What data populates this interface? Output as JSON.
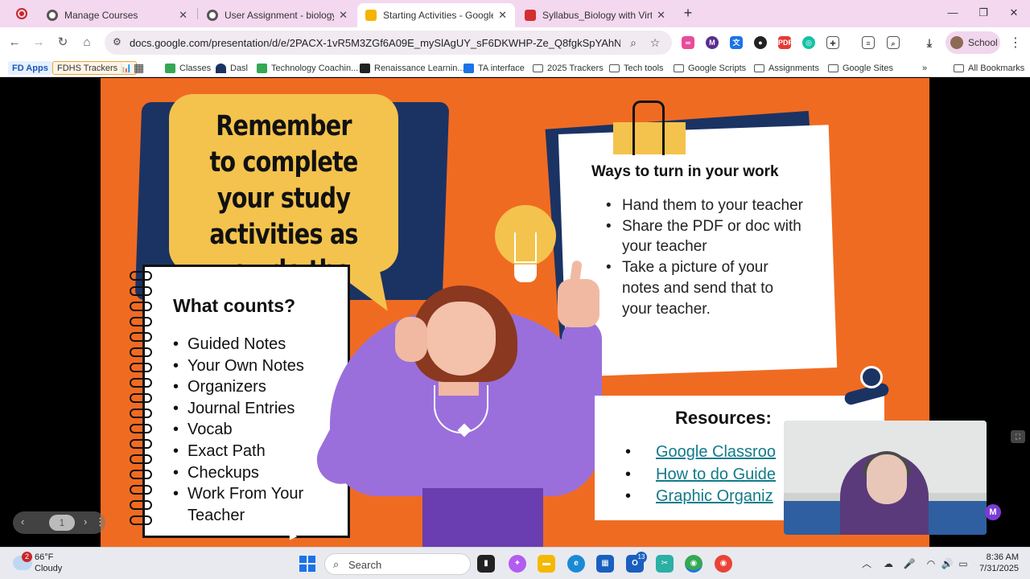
{
  "browser": {
    "tabs": [
      {
        "title": "Manage Courses",
        "icon": "site-icon",
        "active": false
      },
      {
        "title": "User Assignment - biology",
        "icon": "site-icon",
        "active": false
      },
      {
        "title": "Starting Activities - Google Slid",
        "icon": "slides-icon",
        "active": true
      },
      {
        "title": "Syllabus_Biology with Virtual La",
        "icon": "pdf-icon",
        "active": false
      }
    ],
    "url": "docs.google.com/presentation/d/e/2PACX-1vR5M3ZGf6A09E_mySlAgUY_sF6DKWHP-Ze_Q8fgkSpYAhNB5P46bE7yNj...",
    "profile_label": "School",
    "bookmarks": [
      "FD Apps",
      "FDHS Trackers",
      "Classes",
      "Dasl",
      "Technology Coachin...",
      "Renaissance Learnin...",
      "TA interface",
      "2025 Trackers",
      "Tech tools",
      "Google Scripts",
      "Assignments",
      "Google Sites",
      "All Bookmarks"
    ],
    "fdhs_emoji": "📊"
  },
  "slide": {
    "reminder": "Remember to complete your study activities as you do the unit.",
    "what_counts_title": "What counts?",
    "what_counts_items": [
      "Guided Notes",
      "Your Own Notes",
      "Organizers",
      "Journal Entries",
      "Vocab",
      "Exact Path",
      "Checkups",
      "Work From Your Teacher"
    ],
    "ways_title": "Ways to turn in your work",
    "ways_items": [
      "Hand them to your teacher",
      "Share the PDF or doc with your teacher",
      "Take a picture of your notes and send that to your teacher."
    ],
    "resources_title": "Resources:",
    "resources_items": [
      "Google Classroo",
      "How to do Guide",
      "Graphic Organiz"
    ],
    "page_number": "1"
  },
  "taskbar": {
    "weather_temp": "66°F",
    "weather_desc": "Cloudy",
    "weather_badge": "2",
    "search_placeholder": "Search",
    "mail_badge": "13",
    "time": "8:36 AM",
    "date": "7/31/2025"
  },
  "colors": {
    "slide_bg": "#f06b22",
    "navy": "#1b3363",
    "yellow": "#f4c34d",
    "purple": "#9a6fdc",
    "link": "#127a8a"
  }
}
